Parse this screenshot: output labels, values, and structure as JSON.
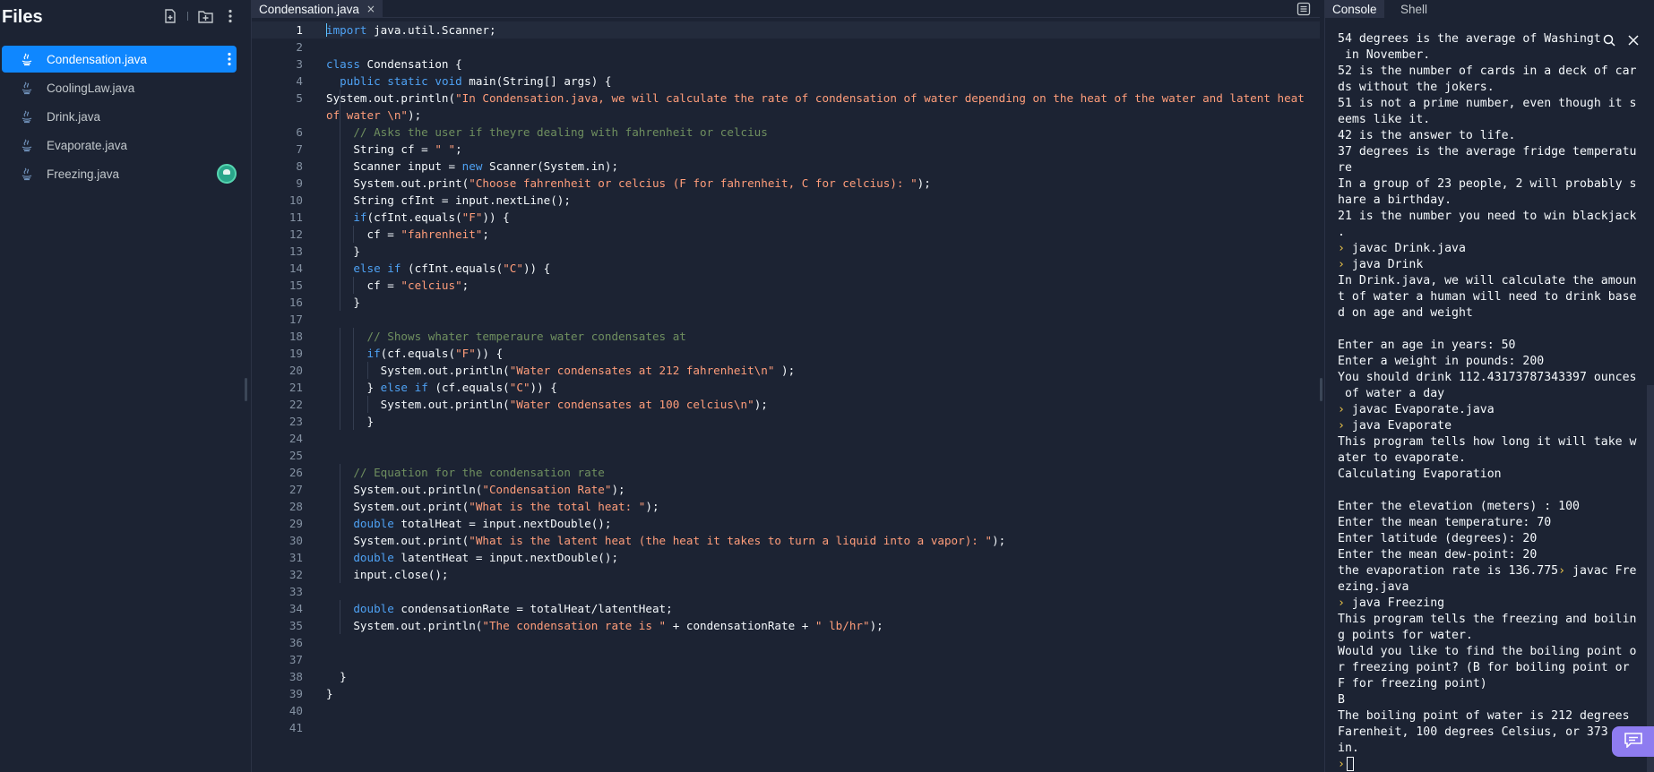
{
  "sidebar": {
    "title": "Files",
    "files": [
      {
        "name": "Condensation.java",
        "active": true
      },
      {
        "name": "CoolingLaw.java",
        "active": false
      },
      {
        "name": "Drink.java",
        "active": false
      },
      {
        "name": "Evaporate.java",
        "active": false
      },
      {
        "name": "Freezing.java",
        "active": false
      }
    ],
    "icons": [
      "new-file-icon",
      "new-folder-icon",
      "more-icon",
      "java-file-icon",
      "avatar"
    ]
  },
  "editor": {
    "tab_label": "Condensation.java",
    "tab_close": "×",
    "lines": [
      {
        "n": "1",
        "t": "import java.util.Scanner;"
      },
      {
        "n": "2",
        "t": ""
      },
      {
        "n": "3",
        "t": "class Condensation {"
      },
      {
        "n": "4",
        "t": "  public static void main(String[] args) {"
      },
      {
        "n": "5",
        "t": "    System.out.println(\"In Condensation.java, we will calculate the rate of condensation of water depending on the heat of the water and latent heat of water \\n\");"
      },
      {
        "n": "6",
        "t": "    // Asks the user if theyre dealing with fahrenheit or celcius"
      },
      {
        "n": "7",
        "t": "    String cf = \" \";"
      },
      {
        "n": "8",
        "t": "    Scanner input = new Scanner(System.in);"
      },
      {
        "n": "9",
        "t": "    System.out.print(\"Choose fahrenheit or celcius (F for fahrenheit, C for celcius): \");"
      },
      {
        "n": "10",
        "t": "    String cfInt = input.nextLine();"
      },
      {
        "n": "11",
        "t": "    if(cfInt.equals(\"F\")) {"
      },
      {
        "n": "12",
        "t": "      cf = \"fahrenheit\";"
      },
      {
        "n": "13",
        "t": "    }"
      },
      {
        "n": "14",
        "t": "    else if (cfInt.equals(\"C\")) {"
      },
      {
        "n": "15",
        "t": "      cf = \"celcius\";"
      },
      {
        "n": "16",
        "t": "    }"
      },
      {
        "n": "17",
        "t": ""
      },
      {
        "n": "18",
        "t": "      // Shows whater temperaure water condensates at"
      },
      {
        "n": "19",
        "t": "      if(cf.equals(\"F\")) {"
      },
      {
        "n": "20",
        "t": "        System.out.println(\"Water condensates at 212 fahrenheit\\n\" );"
      },
      {
        "n": "21",
        "t": "      } else if (cf.equals(\"C\")) {"
      },
      {
        "n": "22",
        "t": "        System.out.println(\"Water condensates at 100 celcius\\n\");"
      },
      {
        "n": "23",
        "t": "      }"
      },
      {
        "n": "24",
        "t": ""
      },
      {
        "n": "25",
        "t": ""
      },
      {
        "n": "26",
        "t": "    // Equation for the condensation rate"
      },
      {
        "n": "27",
        "t": "    System.out.println(\"Condensation Rate\");"
      },
      {
        "n": "28",
        "t": "    System.out.print(\"What is the total heat: \");"
      },
      {
        "n": "29",
        "t": "    double totalHeat = input.nextDouble();"
      },
      {
        "n": "30",
        "t": "    System.out.print(\"What is the latent heat (the heat it takes to turn a liquid into a vapor): \");"
      },
      {
        "n": "31",
        "t": "    double latentHeat = input.nextDouble();"
      },
      {
        "n": "32",
        "t": "    input.close();"
      },
      {
        "n": "33",
        "t": ""
      },
      {
        "n": "34",
        "t": "    double condensationRate = totalHeat/latentHeat;"
      },
      {
        "n": "35",
        "t": "    System.out.println(\"The condensation rate is \" + condensationRate + \" lb/hr\");"
      },
      {
        "n": "36",
        "t": ""
      },
      {
        "n": "37",
        "t": ""
      },
      {
        "n": "38",
        "t": "  }"
      },
      {
        "n": "39",
        "t": "}"
      },
      {
        "n": "40",
        "t": ""
      },
      {
        "n": "41",
        "t": ""
      }
    ],
    "syntax_colors": {
      "keyword": "#4ea1f3",
      "string": "#ff9d7a",
      "comment": "#6f8f5f",
      "text": "#f5f9fc"
    }
  },
  "console": {
    "tabs": [
      {
        "label": "Console",
        "active": true
      },
      {
        "label": "Shell",
        "active": false
      }
    ],
    "prompt_glyph": "›",
    "lines": [
      "54 degrees is the average of Washingt",
      " in November.",
      "52 is the number of cards in a deck of car",
      "ds without the jokers.",
      "51 is not a prime number, even though it s",
      "eems like it.",
      "42 is the answer to life.",
      "37 degrees is the average fridge temperatu",
      "re",
      "In a group of 23 people, 2 will probably s",
      "hare a birthday.",
      "21 is the number you need to win blackjack",
      ".",
      "› javac Drink.java",
      "› java Drink",
      "In Drink.java, we will calculate the amoun",
      "t of water a human will need to drink base",
      "d on age and weight",
      "",
      "Enter an age in years: 50",
      "Enter a weight in pounds: 200",
      "You should drink 112.43173787343397 ounces",
      " of water a day",
      "› javac Evaporate.java",
      "› java Evaporate",
      "This program tells how long it will take w",
      "ater to evaporate.",
      "Calculating Evaporation",
      "",
      "Enter the elevation (meters) : 100",
      "Enter the mean temperature: 70",
      "Enter latitude (degrees): 20",
      "Enter the mean dew-point: 20",
      "the evaporation rate is 136.775› javac Fre",
      "ezing.java",
      "› java Freezing",
      "This program tells the freezing and boilin",
      "g points for water.",
      "Would you like to find the boiling point o",
      "r freezing point? (B for boiling point or",
      "F for freezing point)",
      "B",
      "The boiling point of water is 212 degrees",
      "Farenheit, 100 degrees Celsius, or 373",
      "in.",
      "›"
    ],
    "icons": [
      "search-icon",
      "close-icon",
      "chat-icon"
    ]
  }
}
